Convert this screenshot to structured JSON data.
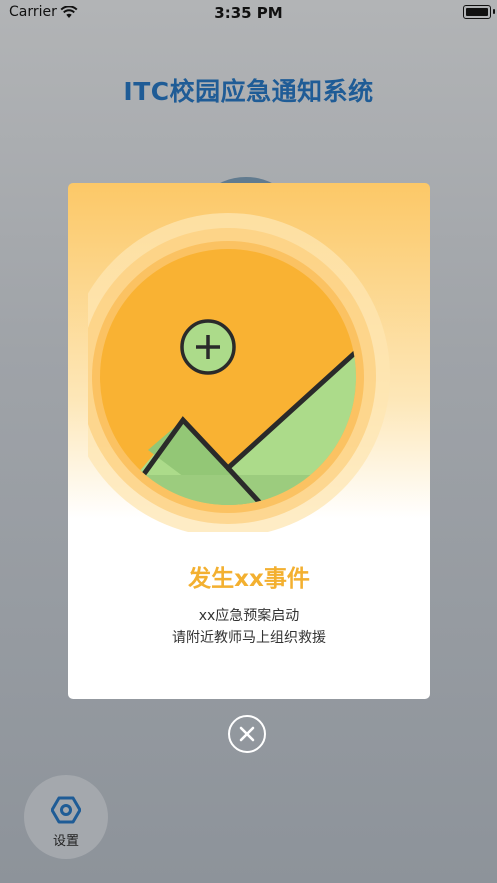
{
  "status_bar": {
    "carrier": "Carrier",
    "time": "3:35 PM"
  },
  "header": {
    "title": "ITC校园应急通知系统"
  },
  "modal": {
    "title": "发生xx事件",
    "message_line1": "xx应急预案启动",
    "message_line2": "请附近教师马上组织救援",
    "illustration": "mountain-landscape-image-icon"
  },
  "actions": {
    "close_icon": "close-circle-icon"
  },
  "settings": {
    "label": "设置",
    "icon": "hexagon-gear-icon"
  },
  "colors": {
    "title_blue": "#1f5c96",
    "accent_orange": "#f3b030",
    "sun_orange": "#f9b233",
    "mountain_green": "#acdb8a"
  }
}
